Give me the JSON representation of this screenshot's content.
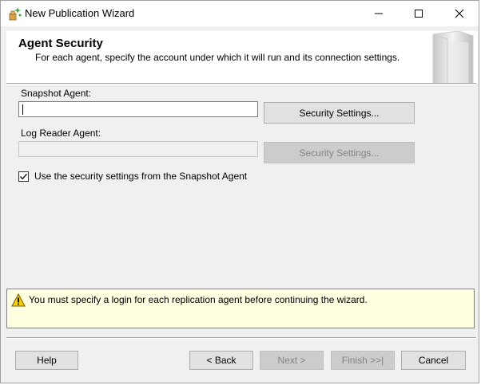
{
  "window": {
    "title": "New Publication Wizard"
  },
  "header": {
    "title": "Agent Security",
    "subtitle": "For each agent, specify the account under which it will run and its connection settings."
  },
  "snapshot_agent": {
    "label": "Snapshot Agent:",
    "value": "",
    "button": "Security Settings..."
  },
  "log_reader_agent": {
    "label": "Log Reader Agent:",
    "value": "",
    "button": "Security Settings..."
  },
  "use_snapshot_settings": {
    "label": "Use the security settings from the Snapshot Agent",
    "checked": true
  },
  "warning": {
    "text": "You must specify a login for each replication agent before continuing the wizard."
  },
  "footer": {
    "help": "Help",
    "back": "< Back",
    "next": "Next >",
    "finish": "Finish >>|",
    "cancel": "Cancel"
  },
  "colors": {
    "warning_bg": "#ffffe1",
    "disabled_text": "#838383"
  }
}
